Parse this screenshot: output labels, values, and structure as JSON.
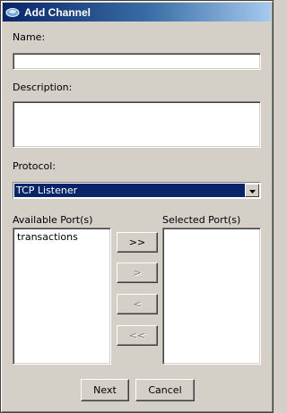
{
  "window": {
    "title": "Add Channel",
    "icon": "channel-app-icon"
  },
  "form": {
    "name_label": "Name:",
    "name_value": "",
    "description_label": "Description:",
    "description_value": "",
    "protocol_label": "Protocol:",
    "protocol_selected": "TCP Listener"
  },
  "ports": {
    "available_label": "Available Port(s)",
    "selected_label": "Selected Port(s)",
    "available_items": [
      "transactions"
    ],
    "selected_items": []
  },
  "transfer_buttons": {
    "add_all": "&gt;&gt;",
    "add": "&gt;",
    "remove": "&lt;",
    "remove_all": "&lt;&lt;"
  },
  "footer": {
    "next_label": "Next",
    "cancel_label": "Cancel"
  },
  "colors": {
    "face": "#d4d0c8",
    "title_start": "#0a246a",
    "title_end": "#a6caf0",
    "selection": "#0a246a"
  }
}
